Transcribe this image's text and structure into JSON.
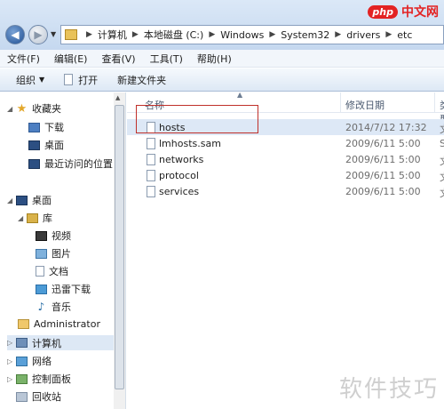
{
  "logo": {
    "php": "php",
    "cn": "中文网"
  },
  "address": {
    "crumbs": [
      "计算机",
      "本地磁盘 (C:)",
      "Windows",
      "System32",
      "drivers",
      "etc"
    ]
  },
  "menu": [
    "文件(F)",
    "编辑(E)",
    "查看(V)",
    "工具(T)",
    "帮助(H)"
  ],
  "toolbar": {
    "organize": "组织",
    "open": "打开",
    "new_folder": "新建文件夹"
  },
  "nav": {
    "favorites": "收藏夹",
    "downloads": "下载",
    "desktop_fav": "桌面",
    "recent": "最近访问的位置",
    "desktop": "桌面",
    "library": "库",
    "videos": "视频",
    "pictures": "图片",
    "documents": "文档",
    "xunlei": "迅雷下载",
    "music": "音乐",
    "administrator": "Administrator",
    "computer": "计算机",
    "network": "网络",
    "control_panel": "控制面板",
    "recycle": "回收站"
  },
  "columns": {
    "name": "名称",
    "date": "修改日期",
    "type": "类型"
  },
  "files": [
    {
      "name": "hosts",
      "date": "2014/7/12 17:32",
      "type": "文"
    },
    {
      "name": "lmhosts.sam",
      "date": "2009/6/11 5:00",
      "type": "S"
    },
    {
      "name": "networks",
      "date": "2009/6/11 5:00",
      "type": "文"
    },
    {
      "name": "protocol",
      "date": "2009/6/11 5:00",
      "type": "文"
    },
    {
      "name": "services",
      "date": "2009/6/11 5:00",
      "type": "文"
    }
  ],
  "watermark": "软件技巧",
  "colors": {
    "highlight_box": "#c0302a",
    "selection": "#dde8f6"
  }
}
